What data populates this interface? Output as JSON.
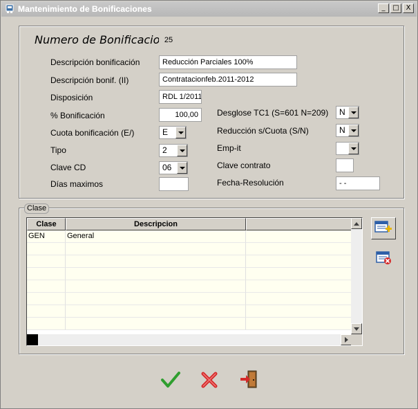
{
  "window": {
    "title": "Mantenimiento de Bonificaciones",
    "controls": {
      "minimize": "_",
      "maximize": "□",
      "close": "X"
    }
  },
  "form": {
    "numero_label": "Numero de Bonificacion:",
    "numero_value": "25",
    "descripcion_label": "Descripción  bonificación",
    "descripcion_value": "Reducción Parciales 100%",
    "descripcion2_label": "Descripción bonif. (II)",
    "descripcion2_value": "Contratacionfeb.2011-2012",
    "disposicion_label": "Disposición",
    "disposicion_value": "RDL 1/2011",
    "porcentaje_label": "% Bonificación",
    "porcentaje_value": "100,00",
    "cuota_label": "Cuota bonificación (E/)",
    "cuota_value": "E",
    "tipo_label": "Tipo",
    "tipo_value": "2",
    "clave_cd_label": "Clave CD",
    "clave_cd_value": "06",
    "dias_label": "Días maximos",
    "dias_value": "",
    "desglose_label": "Desglose  TC1 (S=601 N=209)",
    "desglose_value": "N",
    "reduccion_label": "Reducción s/Cuota (S/N)",
    "reduccion_value": "N",
    "empit_label": "Emp-it",
    "empit_value": "",
    "clave_contrato_label": "Clave contrato",
    "clave_contrato_value": "",
    "fecha_label": "Fecha-Resolución",
    "fecha_value": " -  -"
  },
  "clase_group": {
    "label": "Clase",
    "columns": [
      "Clase",
      "Descripcion",
      ""
    ],
    "rows": [
      [
        "GEN",
        "General",
        ""
      ]
    ]
  },
  "icons": {
    "add": "add-record-icon",
    "delete": "delete-record-icon",
    "ok": "checkmark-icon",
    "cancel": "cancel-x-icon",
    "exit": "exit-door-icon"
  }
}
